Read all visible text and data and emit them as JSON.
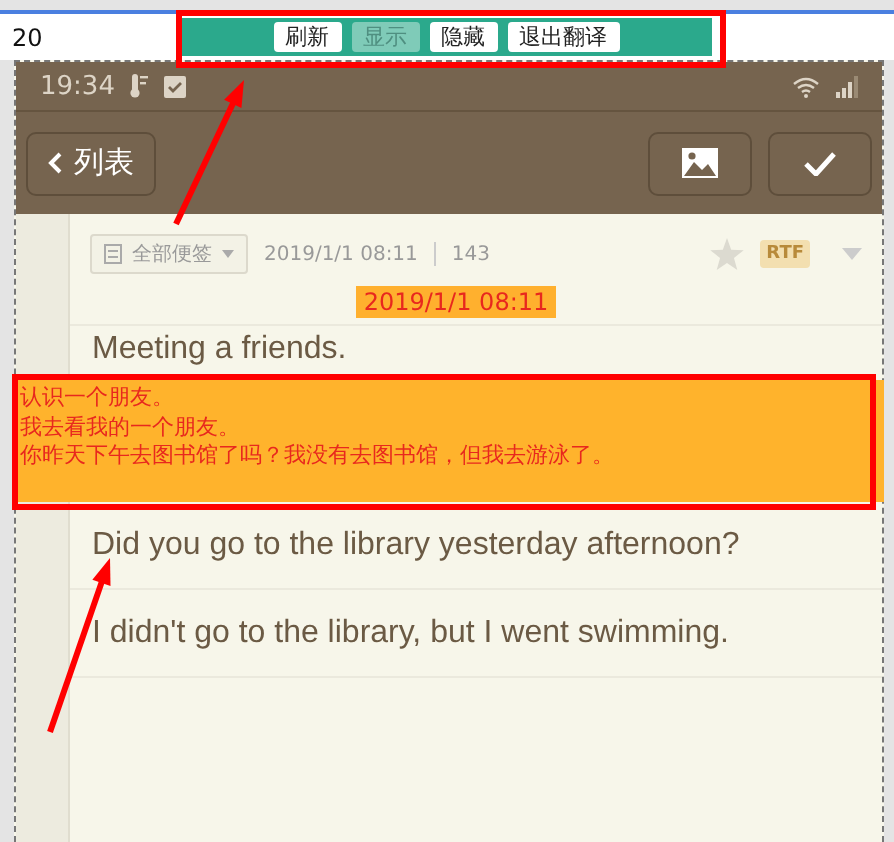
{
  "top_bar": {
    "value": "20",
    "toolbar": [
      {
        "label": "刷新",
        "selected": false
      },
      {
        "label": "显示",
        "selected": true
      },
      {
        "label": "隐藏",
        "selected": false
      },
      {
        "label": "退出翻译",
        "selected": false
      }
    ]
  },
  "status_bar": {
    "time": "19:34"
  },
  "nav_bar": {
    "back_label": "列表"
  },
  "note": {
    "folder": "全部便签",
    "timestamp": "2019/1/1 08:11",
    "count": "143",
    "format": "RTF",
    "date_label": "2019/1/1 08:11",
    "lines": [
      "Meeting a friends.",
      "Did you go to the library yesterday afternoon?",
      "I didn't go to the library, but I went swimming."
    ]
  },
  "translation": {
    "lines": [
      "认识一个朋友。",
      "我去看我的一个朋友。",
      "你昨天下午去图书馆了吗？我没有去图书馆，但我去游泳了。"
    ]
  }
}
